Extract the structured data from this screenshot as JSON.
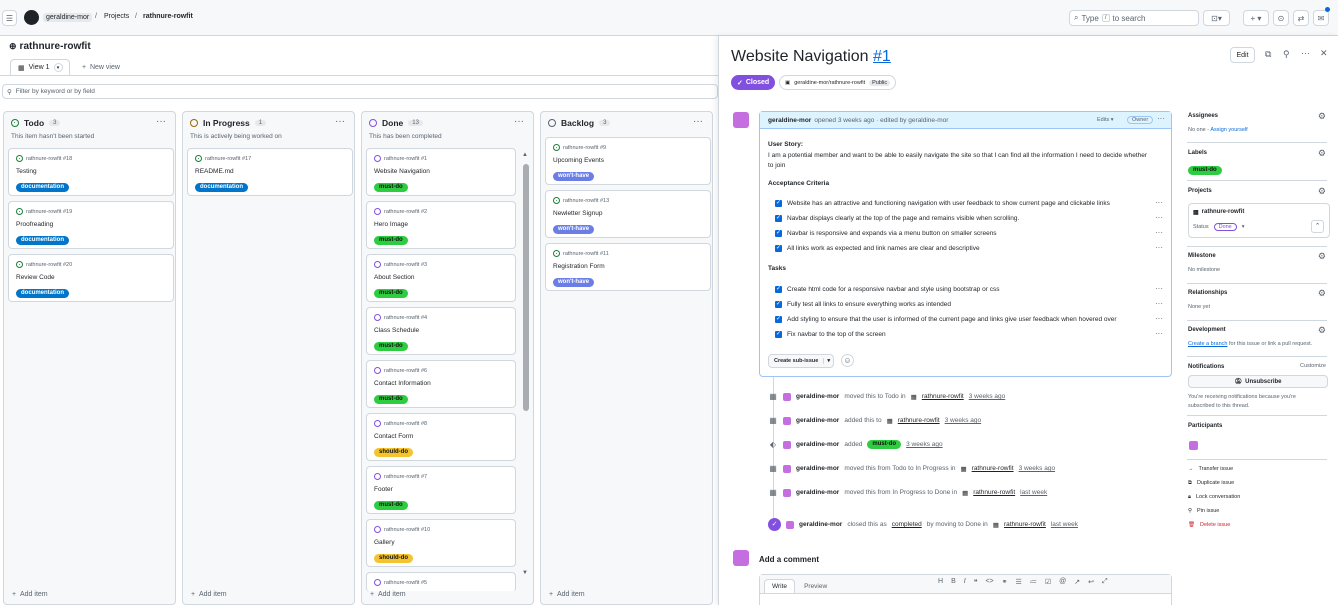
{
  "header": {
    "owner": "geraldine-mor",
    "projects": "Projects",
    "repo": "rathnure-rowfit",
    "search_type": "Type",
    "search_key": "/",
    "search_rest": "to search",
    "plus": "+ ▾"
  },
  "project": {
    "title": "rathnure-rowfit",
    "view_tab": "View 1",
    "new_view": "New view",
    "filter_placeholder": "Filter by keyword or by field"
  },
  "columns": [
    {
      "name": "Todo",
      "count": "3",
      "desc": "This item hasn't been started",
      "cards": [
        {
          "ref": "rathnure-rowfit #18",
          "title": "Testing",
          "label": "documentation"
        },
        {
          "ref": "rathnure-rowfit #19",
          "title": "Proofreading",
          "label": "documentation"
        },
        {
          "ref": "rathnure-rowfit #20",
          "title": "Review Code",
          "label": "documentation"
        }
      ]
    },
    {
      "name": "In Progress",
      "count": "1",
      "desc": "This is actively being worked on",
      "cards": [
        {
          "ref": "rathnure-rowfit #17",
          "title": "README.md",
          "label": "documentation"
        }
      ]
    },
    {
      "name": "Done",
      "count": "13",
      "desc": "This has been completed",
      "cards": [
        {
          "ref": "rathnure-rowfit #1",
          "title": "Website Navigation",
          "label": "must-do"
        },
        {
          "ref": "rathnure-rowfit #2",
          "title": "Hero Image",
          "label": "must-do"
        },
        {
          "ref": "rathnure-rowfit #3",
          "title": "About Section",
          "label": "must-do"
        },
        {
          "ref": "rathnure-rowfit #4",
          "title": "Class Schedule",
          "label": "must-do"
        },
        {
          "ref": "rathnure-rowfit #6",
          "title": "Contact Information",
          "label": "must-do"
        },
        {
          "ref": "rathnure-rowfit #8",
          "title": "Contact Form",
          "label": "should-do"
        },
        {
          "ref": "rathnure-rowfit #7",
          "title": "Footer",
          "label": "must-do"
        },
        {
          "ref": "rathnure-rowfit #10",
          "title": "Gallery",
          "label": "should-do"
        },
        {
          "ref": "rathnure-rowfit #5",
          "title": "",
          "label": ""
        }
      ]
    },
    {
      "name": "Backlog",
      "count": "3",
      "desc": "",
      "cards": [
        {
          "ref": "rathnure-rowfit #9",
          "title": "Upcoming Events",
          "label": "won't-have"
        },
        {
          "ref": "rathnure-rowfit #13",
          "title": "Newletter Signup",
          "label": "won't-have"
        },
        {
          "ref": "rathnure-rowfit #11",
          "title": "Registration Form",
          "label": "won't-have"
        }
      ]
    }
  ],
  "add_item": "Add item",
  "issue": {
    "title": "Website Navigation",
    "number": "#1",
    "edit": "Edit",
    "state": "Closed",
    "repo": "geraldine-mor/rathnure-rowfit",
    "visibility": "Public",
    "author": "geraldine-mor",
    "meta": "opened 3 weeks ago · edited by geraldine-mor",
    "edits": "Edits ▾",
    "owner_badge": "Owner",
    "story_heading": "User Story:",
    "story": "I am a potential member and want to be able to easily navigate the site so that I can find all the information I need to decide whether to join",
    "ac_heading": "Acceptance Criteria",
    "ac": [
      "Website has an attractive and functioning navigation with user feedback to show current page and clickable links",
      "Navbar displays clearly at the top of the page and remains visible when scrolling.",
      "Navbar is responsive and expands via a menu button on smaller screens",
      "All links work as expected and link names are clear and descriptive"
    ],
    "tasks_heading": "Tasks",
    "tasks": [
      "Create html code for a responsive navbar and style using bootstrap or css",
      "Fully test all links to ensure everything works as intended",
      "Add styling to ensure that the user is informed of the current page and links give user feedback when hovered over",
      "Fix navbar to the top of the screen"
    ],
    "sub_issue": "Create sub-issue"
  },
  "timeline": [
    {
      "user": "geraldine-mor",
      "action": "moved this to Todo in",
      "project": "rathnure-rowfit",
      "time": "3 weeks ago"
    },
    {
      "user": "geraldine-mor",
      "action": "added this to",
      "project": "rathnure-rowfit",
      "time": "3 weeks ago"
    },
    {
      "user": "geraldine-mor",
      "action": "added",
      "label": "must-do",
      "time": "3 weeks ago"
    },
    {
      "user": "geraldine-mor",
      "action": "moved this from Todo to In Progress in",
      "project": "rathnure-rowfit",
      "time": "3 weeks ago"
    },
    {
      "user": "geraldine-mor",
      "action": "moved this from In Progress to Done in",
      "project": "rathnure-rowfit",
      "time": "last week"
    },
    {
      "user": "geraldine-mor",
      "action": "closed this as",
      "link": "completed",
      "action2": "by moving to Done in",
      "project": "rathnure-rowfit",
      "time": "last week"
    }
  ],
  "comment": {
    "heading": "Add a comment",
    "write": "Write",
    "preview": "Preview"
  },
  "sidebar": {
    "assignees": "Assignees",
    "no_one": "No one -",
    "assign_yourself": "Assign yourself",
    "labels": "Labels",
    "label": "must-do",
    "projects": "Projects",
    "project_name": "rathnure-rowfit",
    "status_label": "Status",
    "status": "Done",
    "milestone": "Milestone",
    "no_milestone": "No milestone",
    "relationships": "Relationships",
    "none_yet": "None yet",
    "development": "Development",
    "create_branch": "Create a branch",
    "dev_rest": "for this issue or link a pull request.",
    "notifications": "Notifications",
    "customize": "Customize",
    "unsubscribe": "Unsubscribe",
    "notif_note": "You're receiving notifications because you're subscribed to this thread.",
    "participants": "Participants",
    "actions": [
      "Transfer issue",
      "Duplicate issue",
      "Lock conversation",
      "Pin issue",
      "Delete issue"
    ]
  },
  "colors": {
    "accent": "#0969da",
    "closed": "#8250df",
    "danger": "#cf222e"
  }
}
